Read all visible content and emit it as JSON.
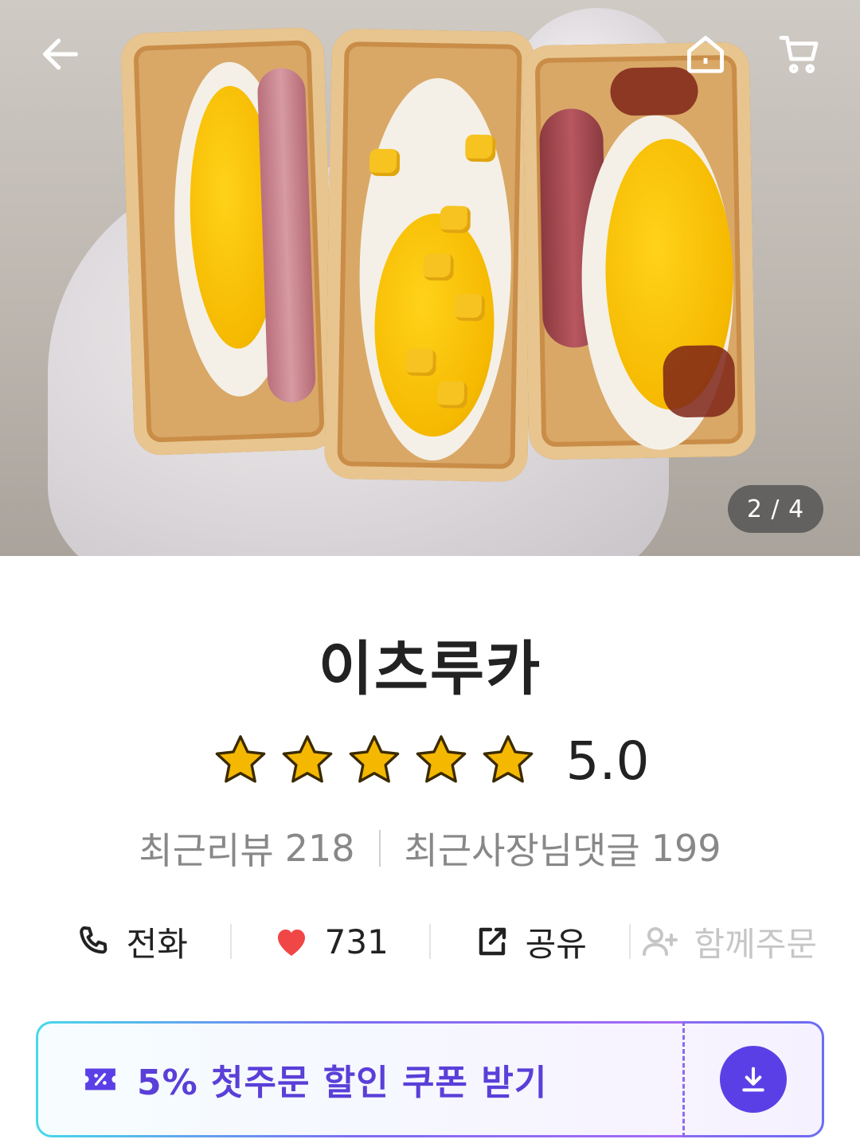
{
  "hero": {
    "pager": "2 / 4",
    "icons": {
      "back": "back-arrow-icon",
      "home": "home-icon",
      "cart": "cart-icon"
    }
  },
  "store": {
    "name": "이츠루카",
    "rating": "5.0",
    "stars": 5,
    "recent_reviews_label": "최근리뷰",
    "recent_reviews_count": "218",
    "owner_comments_label": "최근사장님댓글",
    "owner_comments_count": "199"
  },
  "actions": {
    "call_label": "전화",
    "like_count": "731",
    "share_label": "공유",
    "group_order_label": "함께주문"
  },
  "coupon": {
    "label": "5% 첫주문 할인 쿠폰 받기"
  },
  "colors": {
    "accent": "#5b3fe6",
    "star": "#f5b800",
    "heart": "#f04646"
  }
}
